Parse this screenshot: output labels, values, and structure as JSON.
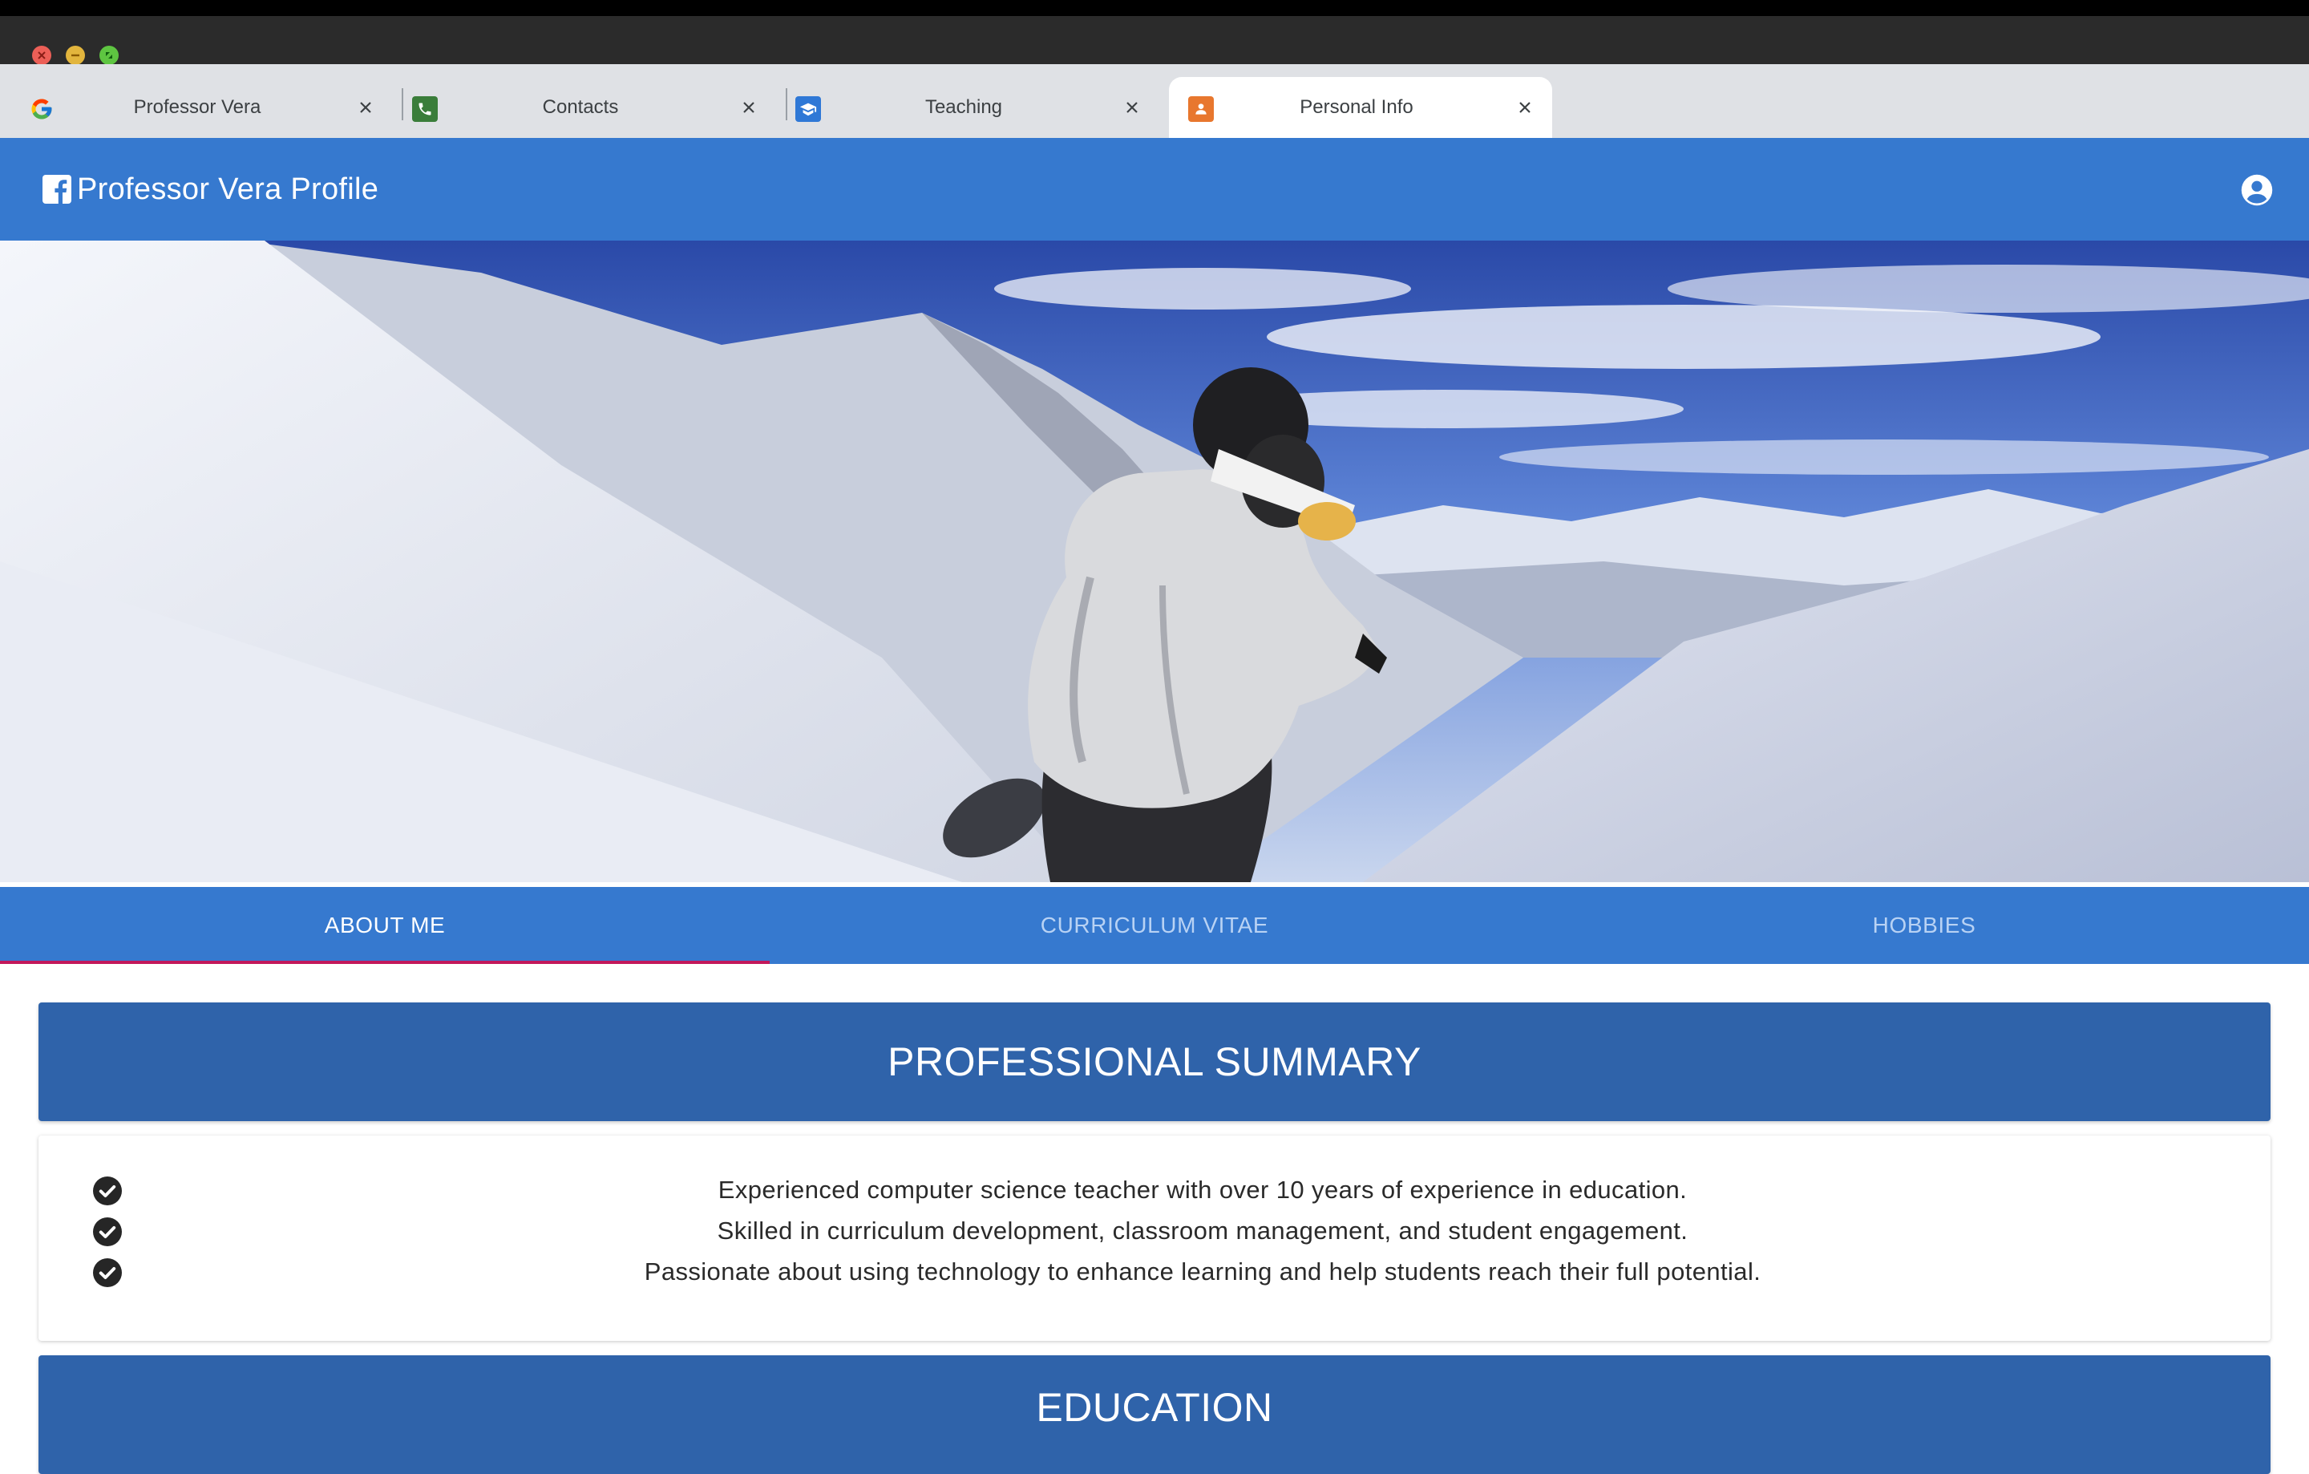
{
  "browser": {
    "tabs": [
      {
        "label": "Professor Vera",
        "favicon": "google-icon",
        "active": false
      },
      {
        "label": "Contacts",
        "favicon": "phone-icon",
        "active": false
      },
      {
        "label": "Teaching",
        "favicon": "graduation-cap-icon",
        "active": false
      },
      {
        "label": "Personal Info",
        "favicon": "person-icon",
        "active": true
      }
    ]
  },
  "header": {
    "title": "Professor Vera Profile",
    "brand_icon": "facebook-icon",
    "account_icon": "account-circle-icon",
    "color": "#3679cf"
  },
  "hero": {
    "image": "snowboarder-on-snowy-mountain-slope"
  },
  "nav": {
    "tabs": [
      {
        "label": "ABOUT ME",
        "active": true
      },
      {
        "label": "CURRICULUM VITAE",
        "active": false
      },
      {
        "label": "HOBBIES",
        "active": false
      }
    ],
    "indicator_color": "#c2185b"
  },
  "summary": {
    "title": "PROFESSIONAL SUMMARY",
    "items": [
      "Experienced computer science teacher with over 10 years of experience in education.",
      "Skilled in curriculum development, classroom management, and student engagement.",
      "Passionate about using technology to enhance learning and help students reach their full potential."
    ],
    "bullet_icon": "check-circle-icon"
  },
  "education": {
    "title": "EDUCATION"
  }
}
